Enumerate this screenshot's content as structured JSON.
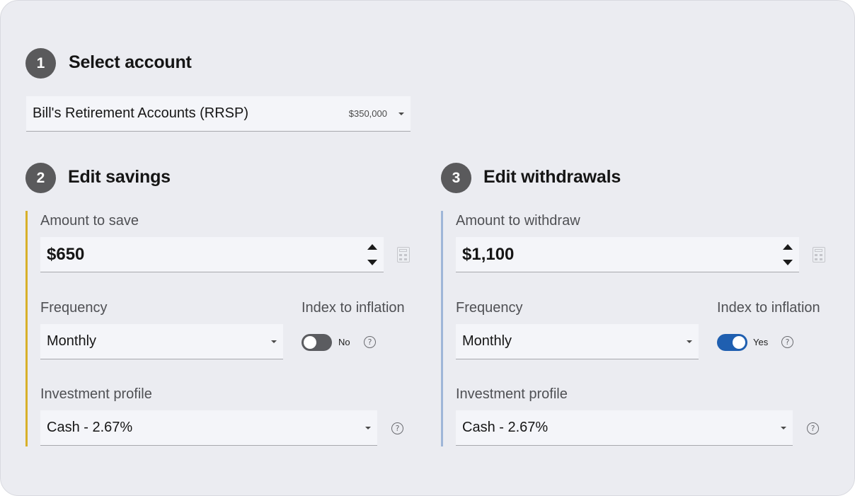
{
  "colors": {
    "savings_accent": "#d8b02a",
    "withdrawals_accent": "#9fb6d8",
    "toggle_on": "#1f5fb0",
    "toggle_off": "#5b5c60",
    "badge": "#5a5a5c"
  },
  "step1": {
    "number": "1",
    "title": "Select account",
    "account": {
      "name": "Bill's Retirement Accounts (RRSP)",
      "balance": "$350,000"
    }
  },
  "step2": {
    "number": "2",
    "title": "Edit savings",
    "amount_label": "Amount to save",
    "amount_value": "$650",
    "frequency_label": "Frequency",
    "frequency_value": "Monthly",
    "inflation_label": "Index to inflation",
    "inflation_state": "No",
    "inflation_on": false,
    "profile_label": "Investment profile",
    "profile_value": "Cash - 2.67%"
  },
  "step3": {
    "number": "3",
    "title": "Edit withdrawals",
    "amount_label": "Amount to  withdraw",
    "amount_value": "$1,100",
    "frequency_label": "Frequency",
    "frequency_value": "Monthly",
    "inflation_label": "Index to inflation",
    "inflation_state": "Yes",
    "inflation_on": true,
    "profile_label": "Investment profile",
    "profile_value": "Cash - 2.67%"
  },
  "icons": {
    "help": "?",
    "calculator": "calculator-icon",
    "dropdown": "chevron-down-icon",
    "stepper": "up-down-arrows-icon"
  }
}
